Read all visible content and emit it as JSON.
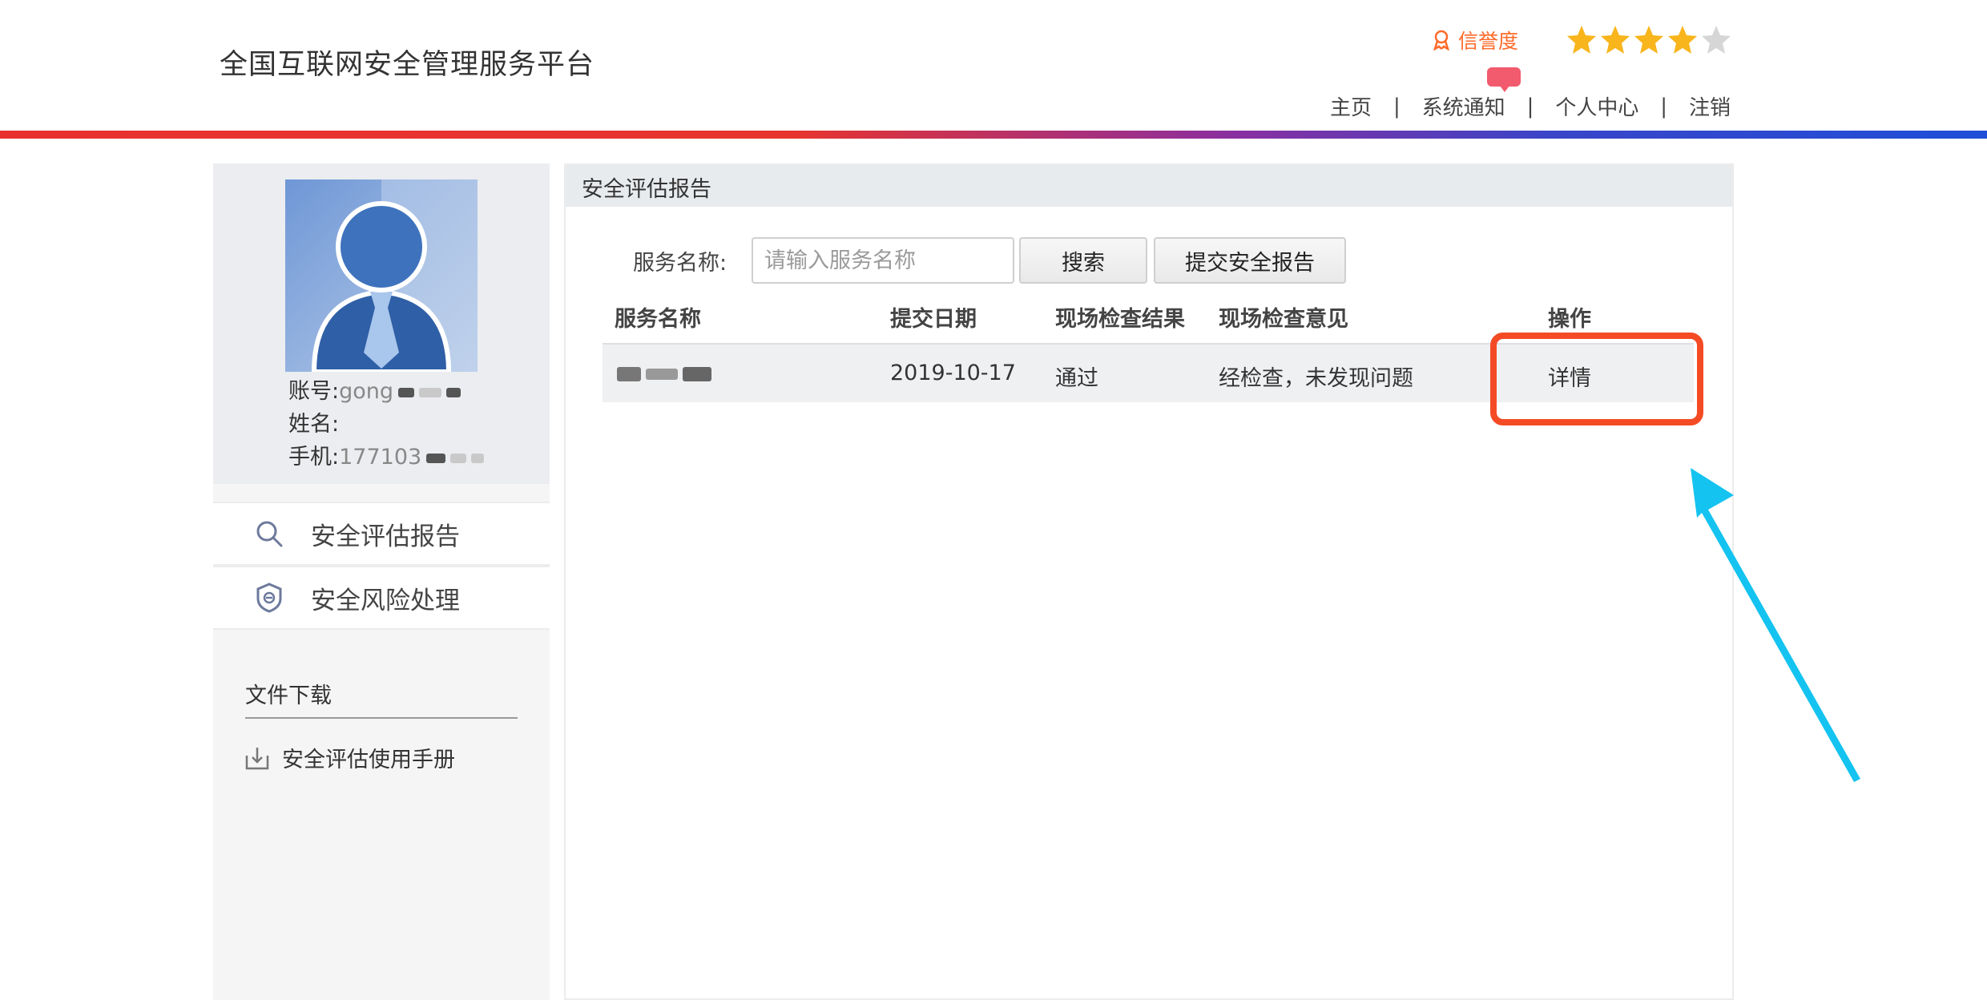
{
  "header": {
    "site_title": "全国互联网安全管理服务平台",
    "credit_label": "信誉度",
    "rating": {
      "value": 4,
      "max": 5
    },
    "nav": [
      {
        "label": "主页"
      },
      {
        "label": "系统通知"
      },
      {
        "label": "个人中心"
      },
      {
        "label": "注销"
      }
    ],
    "nav_separator": "|"
  },
  "profile": {
    "account_label": "账号:",
    "account_value": "gong",
    "name_label": "姓名:",
    "name_value": "",
    "phone_label": "手机:",
    "phone_value": "177103"
  },
  "sidebar": {
    "menu": [
      {
        "label": "安全评估报告",
        "icon": "search-icon"
      },
      {
        "label": "安全风险处理",
        "icon": "shield-icon"
      }
    ],
    "downloads_title": "文件下载",
    "downloads": [
      {
        "label": "安全评估使用手册",
        "icon": "download-icon"
      }
    ]
  },
  "main": {
    "title": "安全评估报告",
    "search": {
      "label": "服务名称:",
      "placeholder": "请输入服务名称",
      "search_button": "搜索",
      "submit_button": "提交安全报告"
    },
    "table": {
      "headers": [
        "服务名称",
        "提交日期",
        "现场检查结果",
        "现场检查意见",
        "操作"
      ],
      "rows": [
        {
          "service": "",
          "date": "2019-10-17",
          "result": "通过",
          "opinion": "经检查，未发现问题",
          "action": "详情"
        }
      ]
    }
  },
  "colors": {
    "highlight": "#f44b25",
    "arrow": "#14c3f0",
    "credit": "#ff6a2a",
    "star": "#f8b51c"
  }
}
